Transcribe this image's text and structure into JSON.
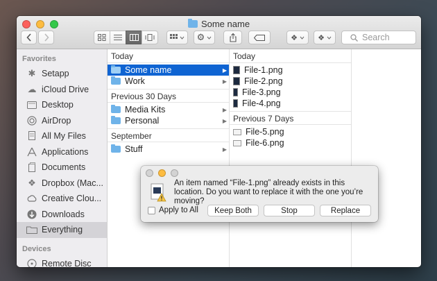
{
  "window": {
    "title": "Some name"
  },
  "toolbar": {
    "search_placeholder": "Search",
    "colors": {
      "close": "#fc605c",
      "minimize": "#fdbc40",
      "zoom": "#34c84a",
      "selection": "#0f64d2"
    }
  },
  "sidebar": {
    "favorites_header": "Favorites",
    "favorites": [
      {
        "label": "Setapp",
        "icon": "setapp-icon"
      },
      {
        "label": "iCloud Drive",
        "icon": "cloud-icon"
      },
      {
        "label": "Desktop",
        "icon": "desktop-icon"
      },
      {
        "label": "AirDrop",
        "icon": "airdrop-icon"
      },
      {
        "label": "All My Files",
        "icon": "files-icon"
      },
      {
        "label": "Applications",
        "icon": "applications-icon"
      },
      {
        "label": "Documents",
        "icon": "documents-icon"
      },
      {
        "label": "Dropbox (Mac...",
        "icon": "dropbox-icon"
      },
      {
        "label": "Creative Clou...",
        "icon": "creative-cloud-icon"
      },
      {
        "label": "Downloads",
        "icon": "downloads-icon"
      },
      {
        "label": "Everything",
        "icon": "folder-icon"
      }
    ],
    "devices_header": "Devices",
    "devices": [
      {
        "label": "Remote Disc",
        "icon": "disc-icon"
      }
    ]
  },
  "column1": {
    "sections": [
      {
        "title": "Today",
        "items": [
          "Some name",
          "Work"
        ]
      },
      {
        "title": "Previous 30 Days",
        "items": [
          "Media Kits",
          "Personal"
        ]
      },
      {
        "title": "September",
        "items": [
          "Stuff"
        ]
      }
    ]
  },
  "column2": {
    "sections": [
      {
        "title": "Today",
        "items": [
          "File-1.png",
          "File-2.png",
          "File-3.png",
          "File-4.png"
        ]
      },
      {
        "title": "Previous 7 Days",
        "items": [
          "File-5.png",
          "File-6.png"
        ]
      }
    ]
  },
  "dialog": {
    "message": "An item named “File-1.png” already exists in this location. Do you want to replace it with the one you’re moving?",
    "apply_to_all": "Apply to All",
    "keep_both": "Keep Both",
    "stop": "Stop",
    "replace": "Replace"
  }
}
